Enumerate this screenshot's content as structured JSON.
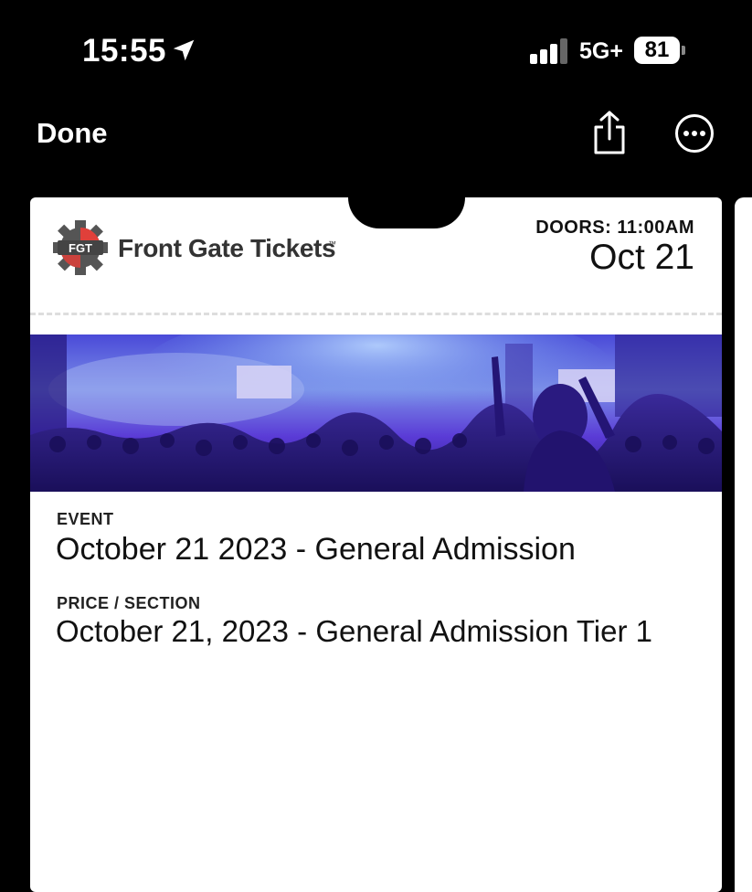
{
  "status_bar": {
    "time": "15:55",
    "network": "5G+",
    "battery": "81",
    "icons": [
      "location-arrow-icon",
      "cellular-signal-icon",
      "battery-icon"
    ]
  },
  "nav": {
    "done_label": "Done",
    "icons": [
      "share-icon",
      "more-icon"
    ]
  },
  "ticket": {
    "logo_badge": "FGT",
    "brand": "Front Gate Tickets",
    "brand_mark": "™",
    "doors": "DOORS: 11:00AM",
    "date": "Oct 21",
    "fields": [
      {
        "label": "EVENT",
        "value": "October 21 2023 - General Admission"
      },
      {
        "label": "PRICE / SECTION",
        "value": "October 21, 2023 - General Admission Tier 1"
      }
    ]
  },
  "colors": {
    "background": "#000000",
    "card": "#ffffff",
    "hero_purple": "#5a3bd6",
    "hero_blue": "#6f9ff0",
    "logo_red": "#e0403a"
  }
}
